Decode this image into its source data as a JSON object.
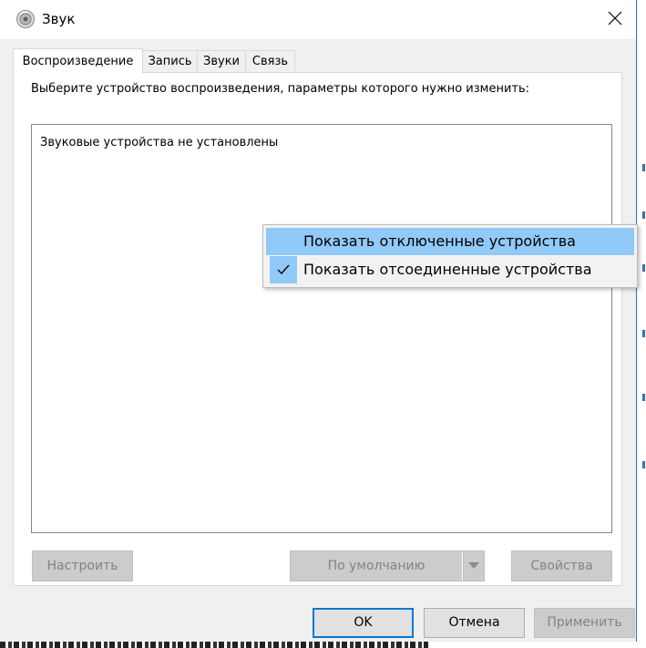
{
  "window": {
    "title": "Звук",
    "icons": {
      "app": "speaker-icon",
      "close": "close-icon",
      "check": "checkmark-icon",
      "dropdown": "chevron-down-icon"
    }
  },
  "tabs": [
    {
      "label": "Воспроизведение",
      "active": true
    },
    {
      "label": "Запись",
      "active": false
    },
    {
      "label": "Звуки",
      "active": false
    },
    {
      "label": "Связь",
      "active": false
    }
  ],
  "playback": {
    "instruction": "Выберите устройство воспроизведения, параметры которого нужно изменить:",
    "empty_message": "Звуковые устройства не установлены"
  },
  "context_menu": {
    "items": [
      {
        "label": "Показать отключенные устройства",
        "checked": false,
        "highlighted": true
      },
      {
        "label": "Показать отсоединенные устройства",
        "checked": true,
        "highlighted": false
      }
    ]
  },
  "panel_buttons": {
    "configure": "Настроить",
    "set_default": "По умолчанию",
    "properties": "Свойства"
  },
  "dialog_buttons": {
    "ok": "OK",
    "cancel": "Отмена",
    "apply": "Применить"
  },
  "colors": {
    "accent": "#0078d7",
    "menu_highlight": "#91c9f7"
  }
}
